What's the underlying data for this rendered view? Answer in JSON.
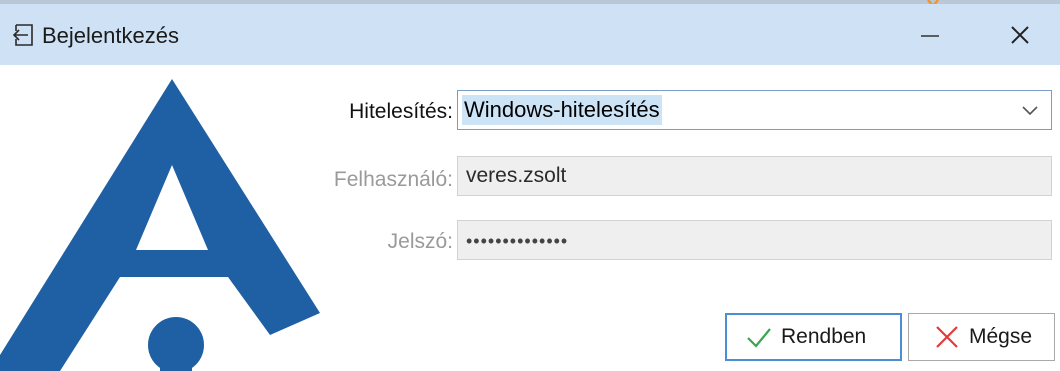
{
  "window": {
    "title": "Bejelentkezés",
    "minimize_glyph": "—",
    "close_glyph": "✕"
  },
  "form": {
    "auth_label": "Hitelesítés:",
    "auth_value": "Windows-hitelesítés",
    "user_label": "Felhasználó:",
    "user_value": "veres.zsolt",
    "password_label": "Jelszó:",
    "password_value": "••••••••••••••"
  },
  "buttons": {
    "ok_label": "Rendben",
    "cancel_label": "Mégse"
  },
  "icons": {
    "title": "login-icon",
    "combo": "chevron-down-icon",
    "ok": "checkmark-icon",
    "cancel": "close-x-icon",
    "logo": "brand-logo"
  },
  "colors": {
    "titlebar": "#cfe2f5",
    "logo_blue": "#1f5fa3",
    "selection": "#cde4f7",
    "ok_check": "#3aa64a",
    "cancel_x": "#e23a3a"
  }
}
